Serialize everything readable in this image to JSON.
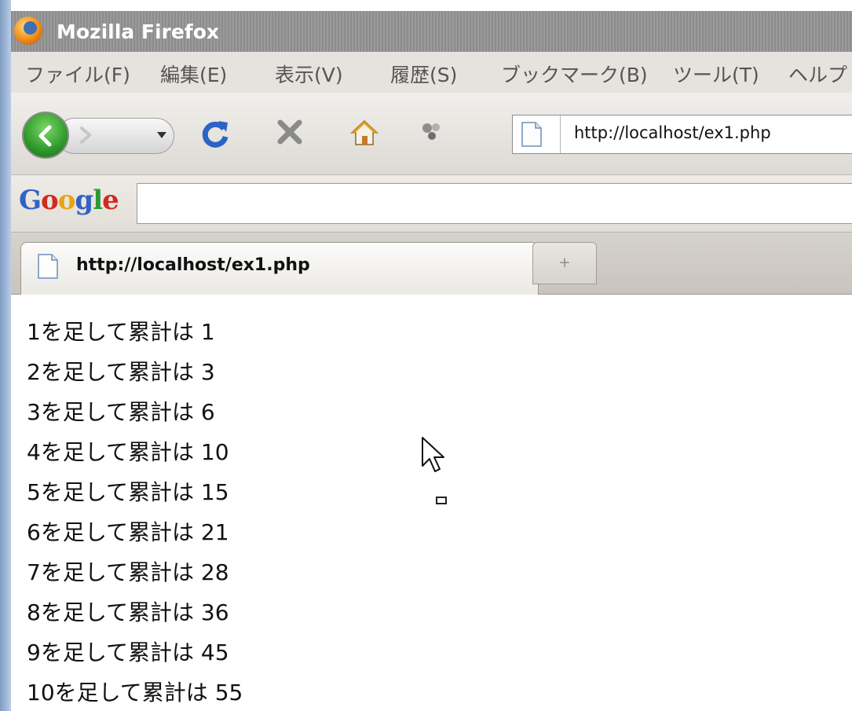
{
  "window": {
    "title": "Mozilla Firefox"
  },
  "menubar": {
    "items": [
      {
        "label": "ファイル(F)"
      },
      {
        "label": "編集(E)"
      },
      {
        "label": "表示(V)"
      },
      {
        "label": "履歴(S)"
      },
      {
        "label": "ブックマーク(B)"
      },
      {
        "label": "ツール(T)"
      },
      {
        "label": "ヘルプ"
      }
    ]
  },
  "navbar": {
    "url": "http://localhost/ex1.php",
    "icons": [
      "back-icon",
      "forward-icon",
      "history-dropdown-icon",
      "reload-icon",
      "stop-icon",
      "home-icon",
      "addon-icon",
      "page-icon"
    ]
  },
  "googlebar": {
    "logo": "Google",
    "query": ""
  },
  "tabs": {
    "active_title": "http://localhost/ex1.php",
    "new_tab_glyph": "+"
  },
  "content": {
    "lines": [
      "1を足して累計は 1",
      "2を足して累計は 3",
      "3を足して累計は 6",
      "4を足して累計は 10",
      "5を足して累計は 15",
      "6を足して累計は 21",
      "7を足して累計は 28",
      "8を足して累計は 36",
      "9を足して累計は 45",
      "10を足して累計は 55"
    ]
  },
  "colors": {
    "titlebar": "#959595",
    "back_button": "#2e9a2b",
    "reload": "#2b63c6",
    "stop": "#8a8a8a",
    "home_roof": "#e7a01b"
  }
}
